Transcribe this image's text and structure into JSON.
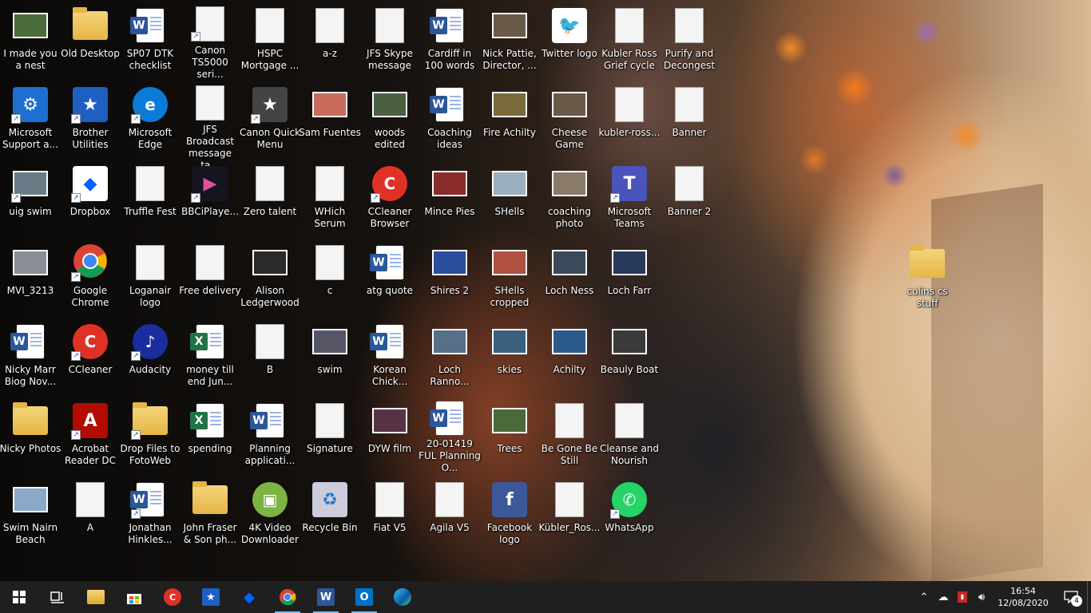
{
  "desktop": {
    "col1": [
      "I made you a nest",
      "Microsoft Support a...",
      "uig swim",
      "MVI_3213",
      "Nicky Marr Biog Nov...",
      "Nicky Photos",
      "Swim Nairn Beach"
    ],
    "col2": [
      "Old Desktop",
      "Brother Utilities",
      "Dropbox",
      "Google Chrome",
      "CCleaner",
      "Acrobat Reader DC",
      "A"
    ],
    "col3": [
      "SP07 DTK checklist",
      "Microsoft Edge",
      "Truffle Fest",
      "Loganair logo",
      "Audacity",
      "Drop Files to FotoWeb",
      "Jonathan Hinkles..."
    ],
    "col4": [
      "Canon TS5000 seri...",
      "JFS Broadcast message ta...",
      "BBCiPlaye...",
      "Free delivery",
      "money till end Jun...",
      "spending",
      "John Fraser & Son ph..."
    ],
    "col5": [
      "HSPC Mortgage ...",
      "Canon Quick Menu",
      "Zero talent",
      "Alison Ledgerwood",
      "B",
      "Planning applicati...",
      "4K Video Downloader"
    ],
    "col6": [
      "a-z",
      "Sam Fuentes",
      "WHich Serum",
      "c",
      "swim",
      "Signature",
      "Recycle Bin"
    ],
    "col7": [
      "JFS Skype message",
      "woods edited",
      "CCleaner Browser",
      "atg quote",
      "Korean Chick...",
      "DYW film",
      "Fiat V5"
    ],
    "col8": [
      "Cardiff in 100 words",
      "Coaching ideas",
      "Mince Pies",
      "Shires 2",
      "Loch Ranno...",
      "20-01419 FUL Planning O...",
      "Agila V5"
    ],
    "col9": [
      "Nick Pattie, Director, ...",
      "Fire Achilty",
      "SHells",
      "SHells cropped",
      "skies",
      "Trees",
      "Facebook logo"
    ],
    "col10": [
      "Twitter logo",
      "Cheese Game",
      "coaching photo",
      "Loch Ness",
      "Achilty",
      "Be Gone Be Still",
      "Kübler_Ros..."
    ],
    "col11": [
      "Kubler Ross Grief cycle",
      "kubler-ross...",
      "Microsoft Teams",
      "Loch Farr",
      "Beauly Boat",
      "Cleanse and Nourish",
      "WhatsApp"
    ],
    "col12": [
      "Purify and Decongest",
      "Banner",
      "Banner 2"
    ],
    "extra": [
      "colins cs stuff"
    ]
  },
  "taskbar": {
    "start_label": "Start",
    "apps": [
      "task-view",
      "file-explorer",
      "microsoft-store",
      "ccleaner",
      "brother-utilities",
      "dropbox",
      "google-chrome",
      "microsoft-word",
      "outlook",
      "microsoft-edge"
    ]
  },
  "tray": {
    "time": "16:54",
    "date": "12/08/2020",
    "notification_count": "4"
  },
  "colors": {
    "taskbar_bg": "#1f1f1f",
    "accent": "#76b9ed",
    "word": "#2b579a",
    "excel": "#217346"
  }
}
